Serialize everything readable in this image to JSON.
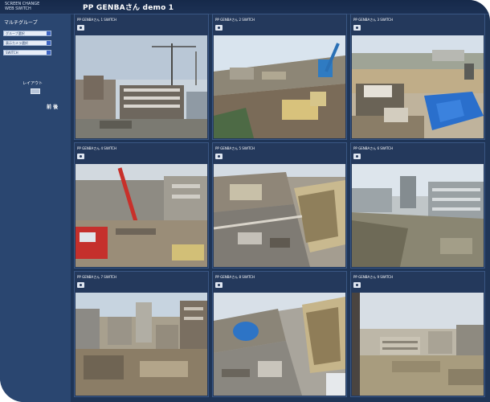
{
  "app": {
    "logo_line1": "SCREEN CHANGE",
    "logo_line2": "WEB SWITCH",
    "page_title": "PP GENBAさん demo 1"
  },
  "sidebar": {
    "group_heading": "マルチグループ",
    "selects": [
      "グループ選択",
      "表示カメラ選択",
      "SWITCH"
    ],
    "layout_label": "レイアウト",
    "pager_label": "前 後"
  },
  "cameras": [
    {
      "title": "PP GENBAさん 1 SWITCH",
      "scene": "buildings-cranes"
    },
    {
      "title": "PP GENBAさん 2 SWITCH",
      "scene": "excavator-site"
    },
    {
      "title": "PP GENBAさん 3 SWITCH",
      "scene": "blue-tarp-yard"
    },
    {
      "title": "PP GENBAさん 4 SWITCH",
      "scene": "red-crane"
    },
    {
      "title": "PP GENBAさん 5 SWITCH",
      "scene": "street-demolition"
    },
    {
      "title": "PP GENBAさん 6 SWITCH",
      "scene": "wide-buildings"
    },
    {
      "title": "PP GENBAさん 7 SWITCH",
      "scene": "city-rooftops"
    },
    {
      "title": "PP GENBAさん 8 SWITCH",
      "scene": "tilted-rubble"
    },
    {
      "title": "PP GENBAさん 9 SWITCH",
      "scene": "window-view"
    }
  ],
  "colors": {
    "background": "#1f3557",
    "sidebar": "#2a4670",
    "tile": "#24395c",
    "tile_border": "#3a5783",
    "select_arrow": "#3f66c4"
  }
}
